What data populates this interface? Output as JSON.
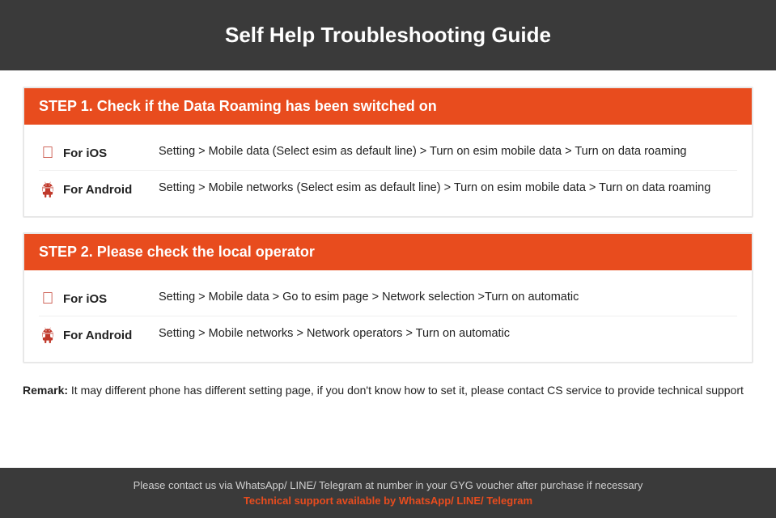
{
  "header": {
    "title": "Self Help Troubleshooting Guide"
  },
  "step1": {
    "heading": "STEP 1.  Check if the Data Roaming has been switched on",
    "rows": [
      {
        "platform": "For iOS",
        "icon_type": "apple",
        "text": "Setting > Mobile data (Select esim as default line) > Turn on esim mobile data > Turn on data roaming"
      },
      {
        "platform": "For Android",
        "icon_type": "android",
        "text": "Setting > Mobile networks (Select esim as default line) > Turn on esim mobile data > Turn on data roaming"
      }
    ]
  },
  "step2": {
    "heading": "STEP 2.  Please check the local operator",
    "rows": [
      {
        "platform": "For iOS",
        "icon_type": "apple",
        "text": "Setting > Mobile data > Go to esim page > Network selection >Turn on automatic"
      },
      {
        "platform": "For Android",
        "icon_type": "android",
        "text": "Setting > Mobile networks > Network operators > Turn on automatic"
      }
    ]
  },
  "remark": {
    "label": "Remark:",
    "text": " It may different phone has different setting page, if you don't know how to set it,  please contact CS service to provide technical support"
  },
  "footer": {
    "main_text": "Please contact us via WhatsApp/ LINE/ Telegram at number in your GYG voucher after purchase if necessary",
    "support_text": "Technical support available by WhatsApp/ LINE/ Telegram"
  }
}
